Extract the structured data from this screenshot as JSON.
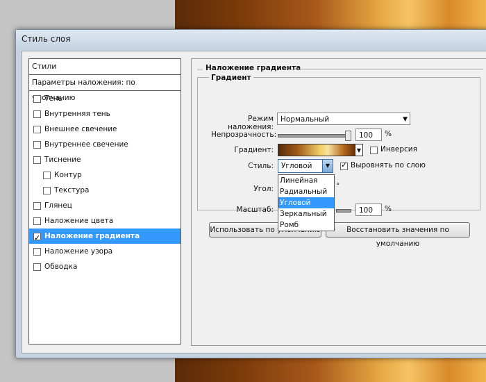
{
  "window": {
    "title": "Стиль слоя"
  },
  "styles_panel": {
    "header": "Стили",
    "blend_options": "Параметры наложения: по умолчанию",
    "items": [
      {
        "label": "Тень",
        "checked": false
      },
      {
        "label": "Внутренняя тень",
        "checked": false
      },
      {
        "label": "Внешнее свечение",
        "checked": false
      },
      {
        "label": "Внутреннее свечение",
        "checked": false
      },
      {
        "label": "Тиснение",
        "checked": false
      },
      {
        "label": "Контур",
        "checked": false
      },
      {
        "label": "Текстура",
        "checked": false
      },
      {
        "label": "Глянец",
        "checked": false
      },
      {
        "label": "Наложение цвета",
        "checked": false
      },
      {
        "label": "Наложение градиента",
        "checked": true
      },
      {
        "label": "Наложение узора",
        "checked": false
      },
      {
        "label": "Обводка",
        "checked": false
      }
    ]
  },
  "gradient_overlay": {
    "section_title": "Наложение градиента",
    "group_title": "Градиент",
    "blend_mode_label": "Режим наложения:",
    "blend_mode_value": "Нормальный",
    "opacity_label": "Непрозрачность:",
    "opacity_value": "100",
    "opacity_unit": "%",
    "gradient_label": "Градиент:",
    "reverse_label": "Инверсия",
    "reverse_checked": false,
    "style_label": "Стиль:",
    "style_value": "Угловой",
    "align_label": "Выровнять по слою",
    "align_checked": true,
    "angle_label": "Угол:",
    "angle_unit": "°",
    "scale_label": "Масштаб:",
    "scale_value": "100",
    "scale_unit": "%",
    "style_options": [
      "Линейная",
      "Радиальный",
      "Угловой",
      "Зеркальный",
      "Ромб"
    ],
    "selected_option": "Угловой",
    "default_button": "Использовать по умолчанию",
    "reset_button": "Восстановить значения по умолчанию"
  },
  "colors": {
    "accent": "#3399ff"
  }
}
